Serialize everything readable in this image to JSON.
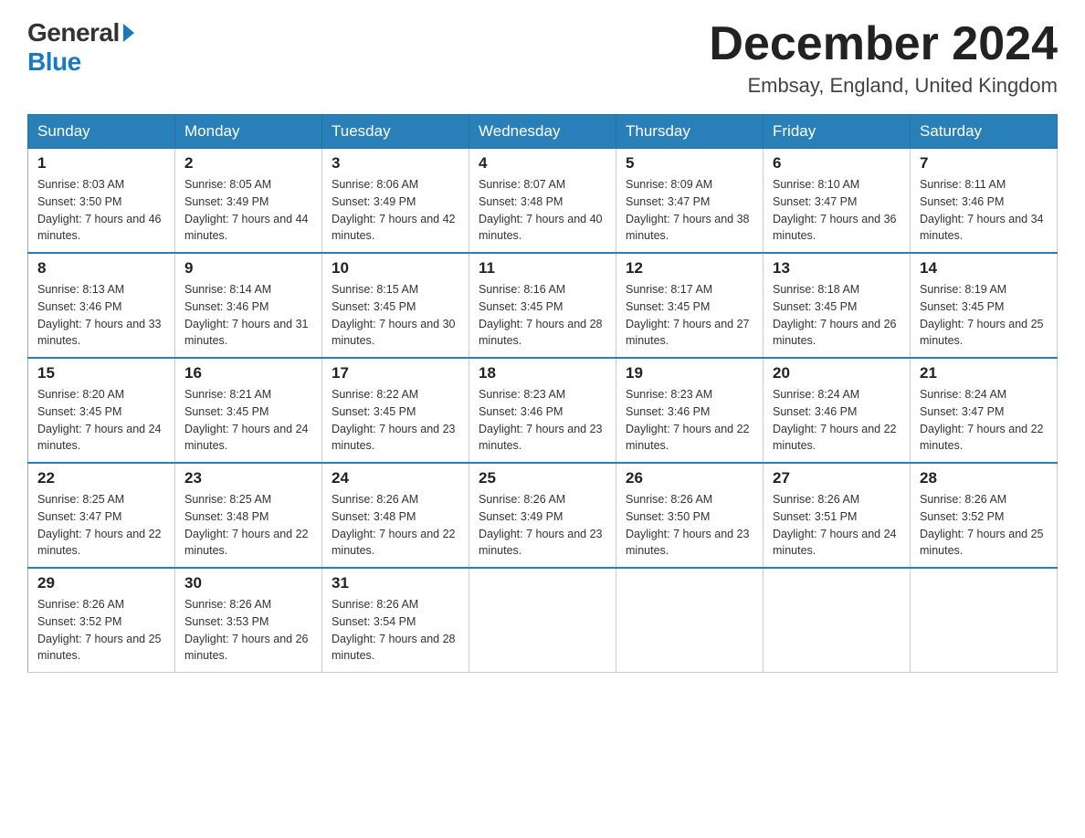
{
  "header": {
    "logo_general": "General",
    "logo_blue": "Blue",
    "month_title": "December 2024",
    "location": "Embsay, England, United Kingdom"
  },
  "days_of_week": [
    "Sunday",
    "Monday",
    "Tuesday",
    "Wednesday",
    "Thursday",
    "Friday",
    "Saturday"
  ],
  "weeks": [
    [
      {
        "day": "1",
        "sunrise": "8:03 AM",
        "sunset": "3:50 PM",
        "daylight": "7 hours and 46 minutes."
      },
      {
        "day": "2",
        "sunrise": "8:05 AM",
        "sunset": "3:49 PM",
        "daylight": "7 hours and 44 minutes."
      },
      {
        "day": "3",
        "sunrise": "8:06 AM",
        "sunset": "3:49 PM",
        "daylight": "7 hours and 42 minutes."
      },
      {
        "day": "4",
        "sunrise": "8:07 AM",
        "sunset": "3:48 PM",
        "daylight": "7 hours and 40 minutes."
      },
      {
        "day": "5",
        "sunrise": "8:09 AM",
        "sunset": "3:47 PM",
        "daylight": "7 hours and 38 minutes."
      },
      {
        "day": "6",
        "sunrise": "8:10 AM",
        "sunset": "3:47 PM",
        "daylight": "7 hours and 36 minutes."
      },
      {
        "day": "7",
        "sunrise": "8:11 AM",
        "sunset": "3:46 PM",
        "daylight": "7 hours and 34 minutes."
      }
    ],
    [
      {
        "day": "8",
        "sunrise": "8:13 AM",
        "sunset": "3:46 PM",
        "daylight": "7 hours and 33 minutes."
      },
      {
        "day": "9",
        "sunrise": "8:14 AM",
        "sunset": "3:46 PM",
        "daylight": "7 hours and 31 minutes."
      },
      {
        "day": "10",
        "sunrise": "8:15 AM",
        "sunset": "3:45 PM",
        "daylight": "7 hours and 30 minutes."
      },
      {
        "day": "11",
        "sunrise": "8:16 AM",
        "sunset": "3:45 PM",
        "daylight": "7 hours and 28 minutes."
      },
      {
        "day": "12",
        "sunrise": "8:17 AM",
        "sunset": "3:45 PM",
        "daylight": "7 hours and 27 minutes."
      },
      {
        "day": "13",
        "sunrise": "8:18 AM",
        "sunset": "3:45 PM",
        "daylight": "7 hours and 26 minutes."
      },
      {
        "day": "14",
        "sunrise": "8:19 AM",
        "sunset": "3:45 PM",
        "daylight": "7 hours and 25 minutes."
      }
    ],
    [
      {
        "day": "15",
        "sunrise": "8:20 AM",
        "sunset": "3:45 PM",
        "daylight": "7 hours and 24 minutes."
      },
      {
        "day": "16",
        "sunrise": "8:21 AM",
        "sunset": "3:45 PM",
        "daylight": "7 hours and 24 minutes."
      },
      {
        "day": "17",
        "sunrise": "8:22 AM",
        "sunset": "3:45 PM",
        "daylight": "7 hours and 23 minutes."
      },
      {
        "day": "18",
        "sunrise": "8:23 AM",
        "sunset": "3:46 PM",
        "daylight": "7 hours and 23 minutes."
      },
      {
        "day": "19",
        "sunrise": "8:23 AM",
        "sunset": "3:46 PM",
        "daylight": "7 hours and 22 minutes."
      },
      {
        "day": "20",
        "sunrise": "8:24 AM",
        "sunset": "3:46 PM",
        "daylight": "7 hours and 22 minutes."
      },
      {
        "day": "21",
        "sunrise": "8:24 AM",
        "sunset": "3:47 PM",
        "daylight": "7 hours and 22 minutes."
      }
    ],
    [
      {
        "day": "22",
        "sunrise": "8:25 AM",
        "sunset": "3:47 PM",
        "daylight": "7 hours and 22 minutes."
      },
      {
        "day": "23",
        "sunrise": "8:25 AM",
        "sunset": "3:48 PM",
        "daylight": "7 hours and 22 minutes."
      },
      {
        "day": "24",
        "sunrise": "8:26 AM",
        "sunset": "3:48 PM",
        "daylight": "7 hours and 22 minutes."
      },
      {
        "day": "25",
        "sunrise": "8:26 AM",
        "sunset": "3:49 PM",
        "daylight": "7 hours and 23 minutes."
      },
      {
        "day": "26",
        "sunrise": "8:26 AM",
        "sunset": "3:50 PM",
        "daylight": "7 hours and 23 minutes."
      },
      {
        "day": "27",
        "sunrise": "8:26 AM",
        "sunset": "3:51 PM",
        "daylight": "7 hours and 24 minutes."
      },
      {
        "day": "28",
        "sunrise": "8:26 AM",
        "sunset": "3:52 PM",
        "daylight": "7 hours and 25 minutes."
      }
    ],
    [
      {
        "day": "29",
        "sunrise": "8:26 AM",
        "sunset": "3:52 PM",
        "daylight": "7 hours and 25 minutes."
      },
      {
        "day": "30",
        "sunrise": "8:26 AM",
        "sunset": "3:53 PM",
        "daylight": "7 hours and 26 minutes."
      },
      {
        "day": "31",
        "sunrise": "8:26 AM",
        "sunset": "3:54 PM",
        "daylight": "7 hours and 28 minutes."
      },
      null,
      null,
      null,
      null
    ]
  ]
}
